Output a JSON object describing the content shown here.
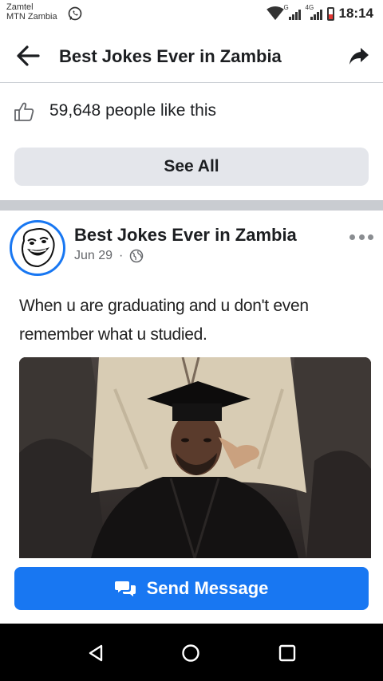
{
  "status_bar": {
    "carrier_line1": "Zamtel",
    "carrier_line2": "MTN Zambia",
    "network_1": "G",
    "network_2": "4G",
    "time": "18:14",
    "icons": [
      "whatsapp-icon",
      "wifi-icon",
      "signal-icon",
      "battery-icon"
    ]
  },
  "header": {
    "title": "Best Jokes Ever in Zambia",
    "back_icon": "arrow-left-icon",
    "share_icon": "share-arrow-icon"
  },
  "page": {
    "likes_text": "59,648 people like this",
    "see_all_label": "See All"
  },
  "post": {
    "author": "Best Jokes Ever in Zambia",
    "date": "Jun 29",
    "separator": "·",
    "privacy_icon": "globe-icon",
    "text": "When u are graduating and u don't even remember what u studied."
  },
  "actions": {
    "send_message_label": "Send Message"
  },
  "colors": {
    "accent": "#1877f2",
    "button_gray": "#e4e6eb",
    "divider": "#c9ccd1"
  }
}
